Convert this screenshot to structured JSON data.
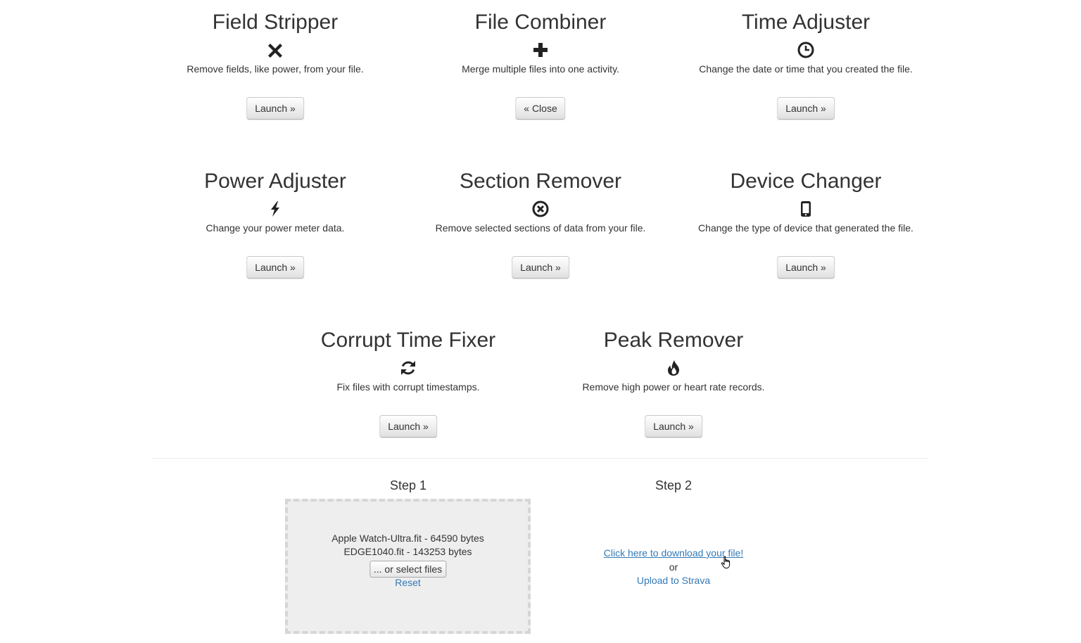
{
  "tools": [
    {
      "id": "field-stripper",
      "title": "Field Stripper",
      "icon": "times-icon",
      "description": "Remove fields, like power, from your file.",
      "button": "Launch »"
    },
    {
      "id": "file-combiner",
      "title": "File Combiner",
      "icon": "plus-icon",
      "description": "Merge multiple files into one activity.",
      "button": "« Close"
    },
    {
      "id": "time-adjuster",
      "title": "Time Adjuster",
      "icon": "clock-icon",
      "description": "Change the date or time that you created the file.",
      "button": "Launch »"
    },
    {
      "id": "power-adjuster",
      "title": "Power Adjuster",
      "icon": "flash-icon",
      "description": "Change your power meter data.",
      "button": "Launch »"
    },
    {
      "id": "section-remover",
      "title": "Section Remover",
      "icon": "remove-circle-icon",
      "description": "Remove selected sections of data from your file.",
      "button": "Launch »"
    },
    {
      "id": "device-changer",
      "title": "Device Changer",
      "icon": "phone-icon",
      "description": "Change the type of device that generated the file.",
      "button": "Launch »"
    },
    {
      "id": "corrupt-time-fixer",
      "title": "Corrupt Time Fixer",
      "icon": "refresh-icon",
      "description": "Fix files with corrupt timestamps.",
      "button": "Launch »"
    },
    {
      "id": "peak-remover",
      "title": "Peak Remover",
      "icon": "fire-icon",
      "description": "Remove high power or heart rate records.",
      "button": "Launch »"
    }
  ],
  "step1": {
    "title": "Step 1",
    "files": [
      "Apple Watch-Ultra.fit - 64590 bytes",
      "EDGE1040.fit - 143253 bytes"
    ],
    "select_button": "... or select files",
    "reset_link": "Reset"
  },
  "step2": {
    "title": "Step 2",
    "download_link": "Click here to download your file!",
    "or_text": "or",
    "strava_link": "Upload to Strava"
  },
  "colors": {
    "text": "#333333",
    "link": "#337ab7",
    "dropzone_bg": "#eeeeee",
    "dropzone_border": "#d6d6d6"
  }
}
